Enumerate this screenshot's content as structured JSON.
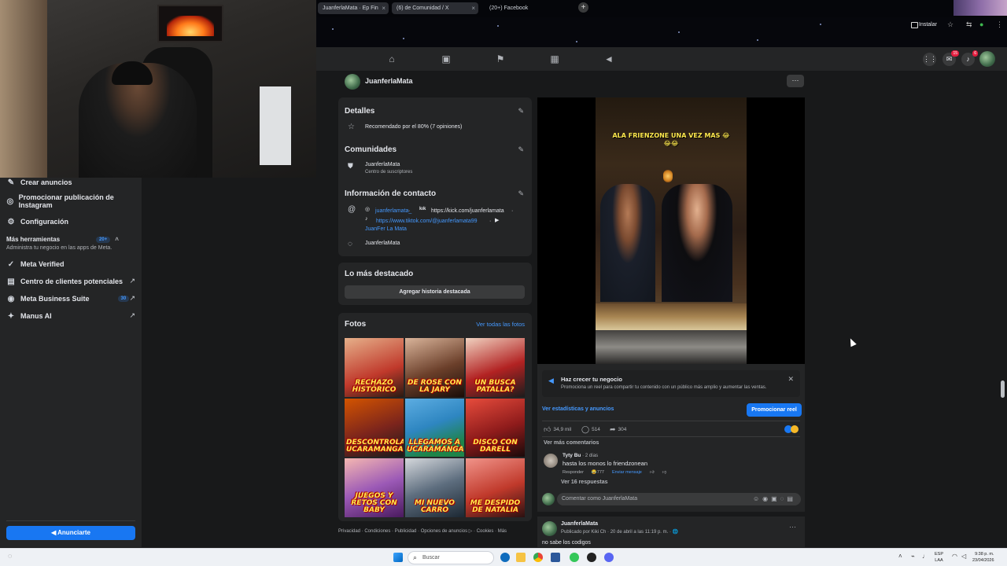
{
  "browser": {
    "tabs": [
      {
        "label": "JuanferlaMata · Ep  Fin",
        "close": "×"
      },
      {
        "label": "(6) de Comunidad / X",
        "close": "×"
      },
      {
        "label": "(20+) Facebook",
        "close": "×"
      }
    ],
    "new_tab": "+",
    "install_label": "Instalar"
  },
  "sidebar": {
    "items": [
      {
        "icon": "megaphone-icon",
        "glyph": "✎",
        "label": "Crear anuncios"
      },
      {
        "icon": "instagram-icon",
        "glyph": "◎",
        "label": "Promocionar publicación de Instagram"
      },
      {
        "icon": "gear-icon",
        "glyph": "⚙",
        "label": "Configuración"
      }
    ],
    "more_tools": {
      "label": "Más herramientas",
      "badge": "20+",
      "sub": "Administra tu negocio en las apps de Meta."
    },
    "tools": [
      {
        "icon": "verified-icon",
        "glyph": "✓",
        "label": "Meta Verified",
        "badge": "",
        "ext": ""
      },
      {
        "icon": "leads-icon",
        "glyph": "▤",
        "label": "Centro de clientes potenciales",
        "badge": "",
        "ext": "↗"
      },
      {
        "icon": "business-suite-icon",
        "glyph": "◉",
        "label": "Meta Business Suite",
        "badge": "30",
        "ext": "↗"
      },
      {
        "icon": "manus-icon",
        "glyph": "✦",
        "label": "Manus AI",
        "badge": "",
        "ext": "↗"
      }
    ],
    "cta": "Anunciarte"
  },
  "page": {
    "name": "JuanferlaMata",
    "more": "···"
  },
  "details": {
    "title": "Detalles",
    "recommendation": "Recomendado por el 80% (7 opiniones)"
  },
  "communities": {
    "title": "Comunidades",
    "name": "JuanferlaMata",
    "sub": "Centro de suscriptores"
  },
  "contact": {
    "title": "Información de contacto",
    "instagram": "juanferlamata_",
    "kick": "https://kick.com/juanferlamata",
    "tiktok": "https://www.tiktok.com/@juanferlamata99",
    "youtube": "JuanFer La Mata",
    "messenger": "JuanferlaMata",
    "sep": "·"
  },
  "highlights": {
    "title": "Lo más destacado",
    "button": "Agregar historia destacada"
  },
  "photos": {
    "title": "Fotos",
    "see_all": "Ver todas las fotos",
    "items": [
      {
        "caption": "RECHAZO HISTÓRICO",
        "bg": "linear-gradient(160deg,#e6b08a,#c0392b 60%,#2b1b12)"
      },
      {
        "caption": "DE ROSE CON LA JARY",
        "bg": "linear-gradient(160deg,#d9b49a,#6b3f2a 55%,#1a0d08)"
      },
      {
        "caption": "UN BUSCA PATALLA?",
        "bg": "linear-gradient(160deg,#f0d2c0,#b22222 55%,#1c1c1c)"
      },
      {
        "caption": "DESCONTROLAMOS UCARAMANGA",
        "bg": "linear-gradient(160deg,#d35400,#7b241c 55%,#1b1b1b)"
      },
      {
        "caption": "LLEGAMOS A UCARAMANGA",
        "bg": "linear-gradient(160deg,#5dade2,#2e86c1 45%,#1e8449 80%)"
      },
      {
        "caption": "DISCO CON DARELL",
        "bg": "linear-gradient(160deg,#e74c3c,#8e1b1b 55%,#1a0a0a)"
      },
      {
        "caption": "JUEGOS Y RETOS CON BABY",
        "bg": "linear-gradient(160deg,#f5b7b1,#9b59b6 50%,#4a1a5e)"
      },
      {
        "caption": "MI NUEVO CARRO",
        "bg": "linear-gradient(160deg,#d5d8dc,#5d6d7e 50%,#1c2833)"
      },
      {
        "caption": "ME DESPIDO DE NATALIA",
        "bg": "linear-gradient(160deg,#f1948a,#c0392b 55%,#2c1010)"
      }
    ]
  },
  "footer": "Privacidad · Condiciones · Publicidad · Opciones de anuncios ▷ · Cookies · Más",
  "reel": {
    "caption": "ALA FRIENZONE UNA VEZ MAS 😂😂😂",
    "promo_title": "Haz crecer tu negocio",
    "promo_sub": "Promociona un reel para compartir tu contenido con un público más amplio y aumentar las ventas.",
    "stats_link": "Ver estadísticas y anuncios",
    "promote_button": "Promocionar reel",
    "likes": "34,9 mil",
    "comments": "514",
    "shares": "304",
    "more_comments": "Ver más comentarios",
    "comment": {
      "author": "Tyty Bu",
      "time": "· 2 días",
      "text": "hasta los monos lo friendzonean",
      "reply": "Responder",
      "reacts": "😂777",
      "send": "Enviar mensaje"
    },
    "replies": "Ver 16 respuestas",
    "comment_placeholder": "Comentar como JuanferlaMata"
  },
  "post2": {
    "author": "JuanferlaMata",
    "meta": "Publicado por Kiki Ch · 20 de abril a las 11:19 p. m. · 🌐",
    "text": "no sabe los codigos",
    "more": "···"
  },
  "taskbar": {
    "search": "Buscar",
    "lang_top": "ESP",
    "lang_bottom": "LAA",
    "time": "9:38 p. m.",
    "date": "23/04/2026"
  }
}
